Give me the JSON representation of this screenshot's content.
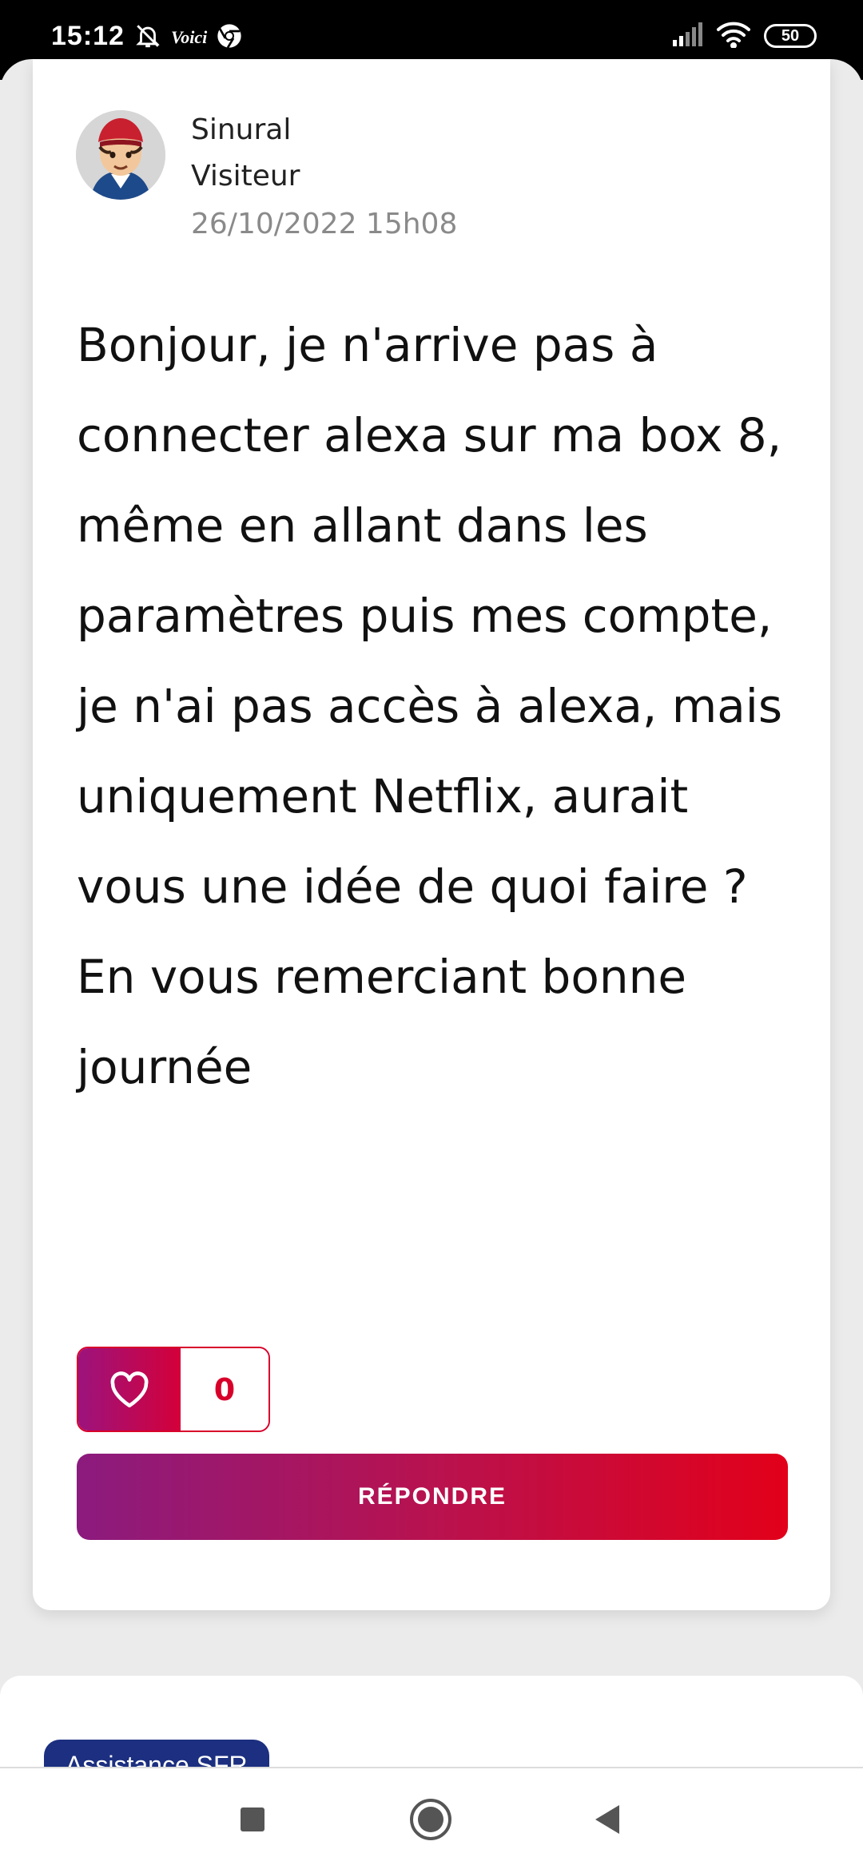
{
  "status_bar": {
    "time": "15:12",
    "carrier_badge": "Voici",
    "battery": "50",
    "icons": [
      "bell-muted-icon",
      "chrome-icon",
      "signal-icon",
      "wifi-icon",
      "battery-icon"
    ]
  },
  "post": {
    "author": "Sinural",
    "role": "Visiteur",
    "date": "26/10/2022 15h08",
    "body": "Bonjour, je n'arrive pas à connecter alexa sur ma box 8, même en allant dans les paramètres puis mes compte, je n'ai pas accès à alexa, mais uniquement Netflix, aurait vous une idée de quoi faire ?\nEn vous remerciant bonne journée",
    "likes": "0",
    "reply_label": "RÉPONDRE"
  },
  "next_post": {
    "tag": "Assistance SFR"
  },
  "colors": {
    "accent_start": "#8b1b7e",
    "accent_end": "#e2001a",
    "tag_bg": "#1c2f80"
  }
}
